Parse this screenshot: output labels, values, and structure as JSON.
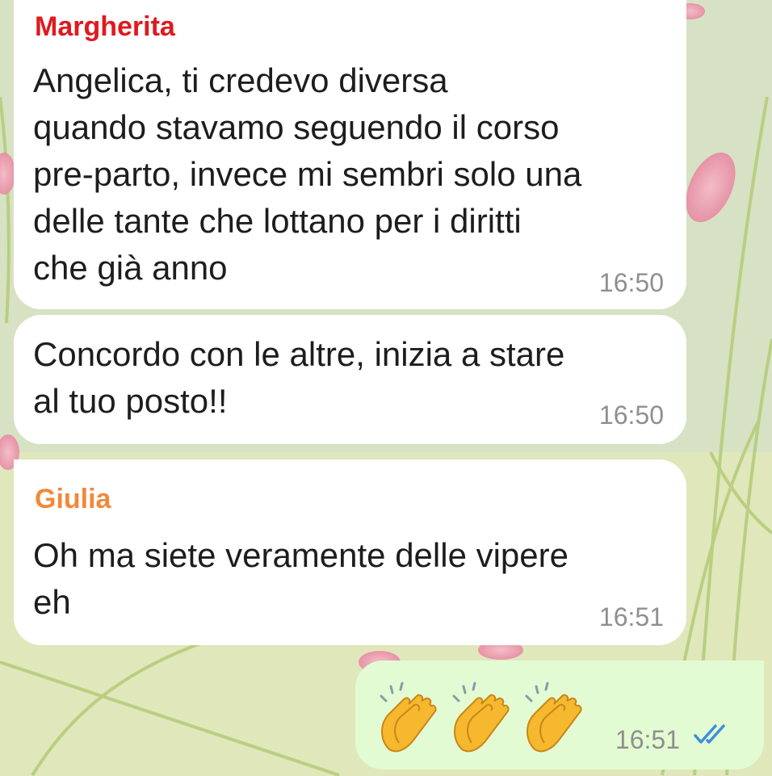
{
  "messages": [
    {
      "sender": "Margherita",
      "sender_color": "#e0191f",
      "text": "Angelica, ti credevo diversa\nquando stavamo seguendo il corso\npre-parto, invece mi sembri solo una\ndelle tante che lottano per i diritti\nche già anno",
      "time": "16:50"
    },
    {
      "text": "Concordo con le altre, inizia a stare\nal tuo posto!!",
      "time": "16:50"
    },
    {
      "sender": "Giulia",
      "sender_color": "#f2883a",
      "text": "Oh ma siete veramente delle vipere\neh",
      "time": "16:51"
    },
    {
      "outgoing": true,
      "emoji_icon": "clapping-hands-icon",
      "emoji_count": 3,
      "time": "16:51",
      "status": "read",
      "status_icon": "double-check-icon",
      "status_color": "#3d8fd8"
    }
  ],
  "colors": {
    "incoming_bubble": "#ffffff",
    "outgoing_bubble": "#e3fbd3",
    "time_text": "#8f8f8f"
  }
}
